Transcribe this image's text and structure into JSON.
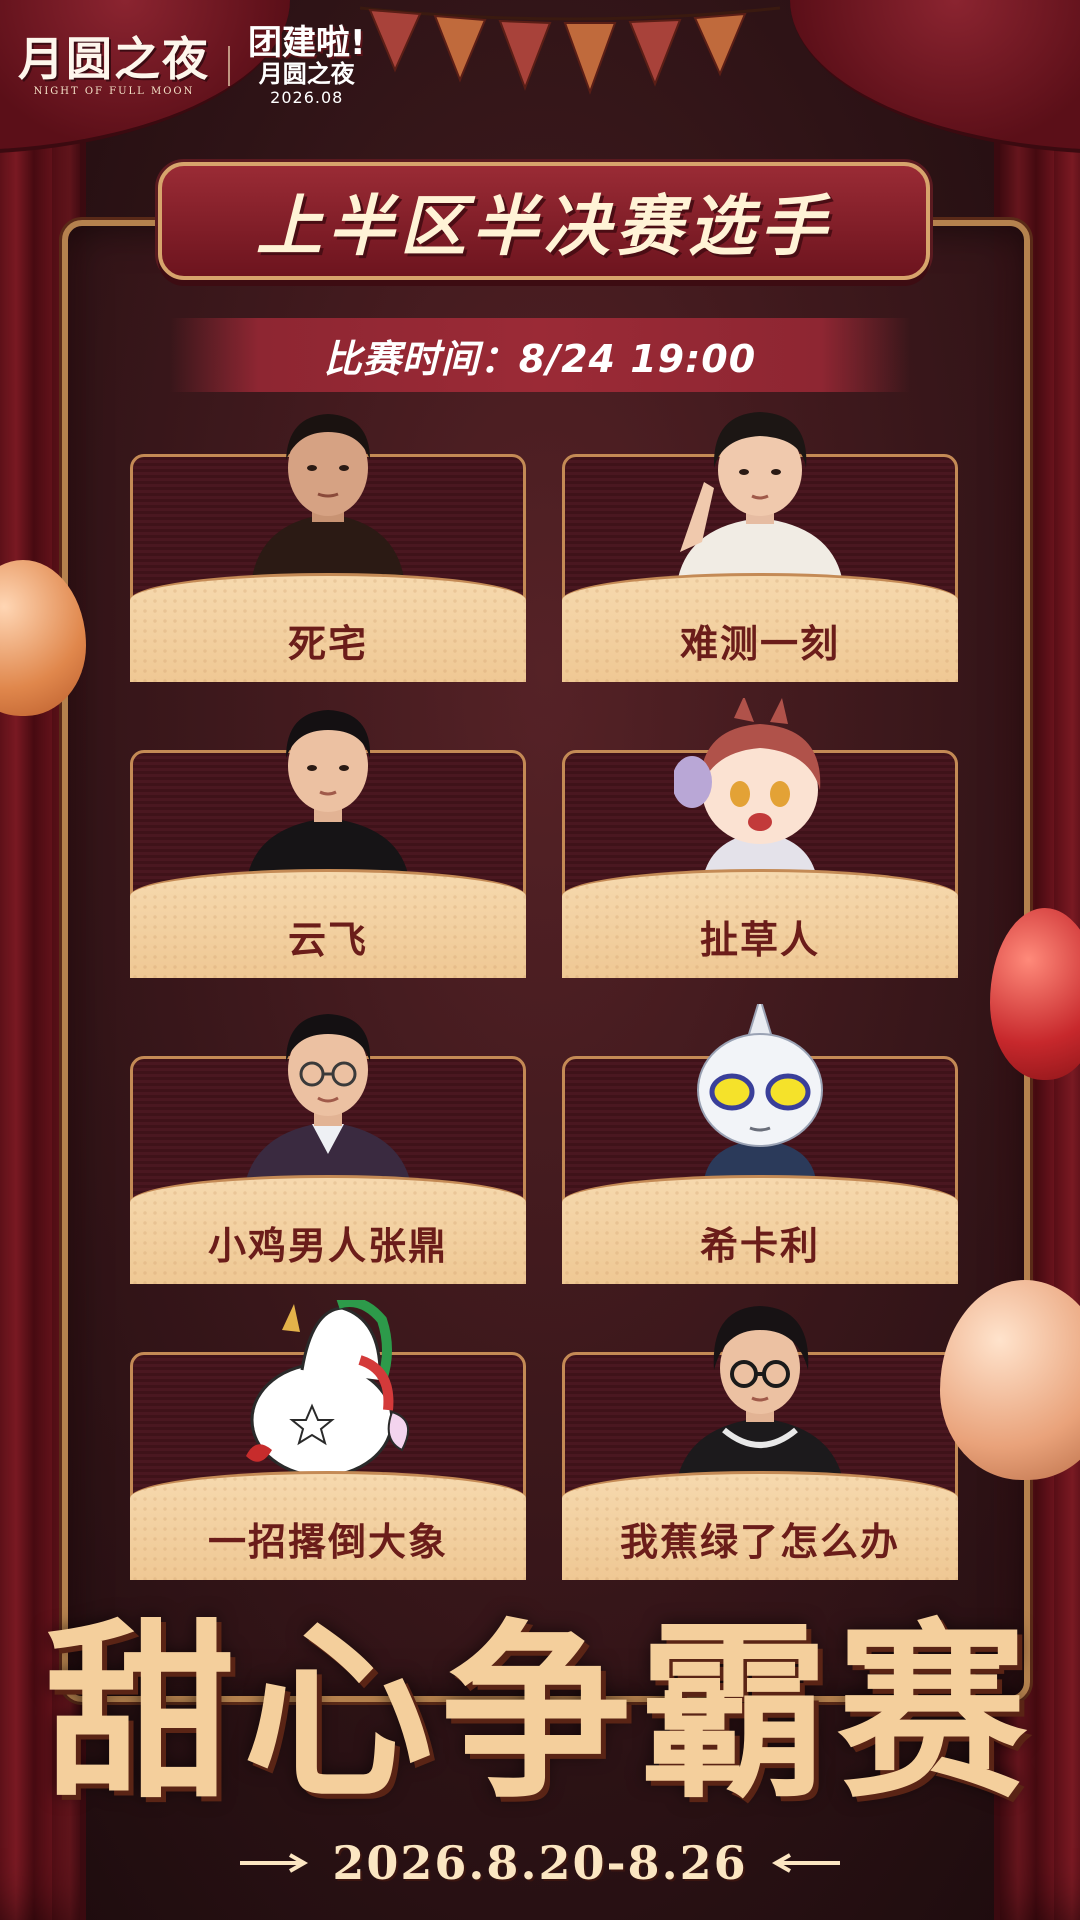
{
  "brand": {
    "logo_main": "月圆之夜",
    "logo_sub": "NIGHT OF FULL MOON",
    "event_title": "团建啦!",
    "event_sub": "月圆之夜",
    "event_date": "2026.08"
  },
  "header": {
    "title": "上半区半决赛选手",
    "match_time": "比赛时间：8/24 19:00"
  },
  "players": [
    {
      "name": "死宅",
      "avatar_icon": "player-photo-icon"
    },
    {
      "name": "难测一刻",
      "avatar_icon": "player-photo-icon"
    },
    {
      "name": "云飞",
      "avatar_icon": "player-photo-icon"
    },
    {
      "name": "扯草人",
      "avatar_icon": "anime-girl-avatar-icon"
    },
    {
      "name": "小鸡男人张鼎",
      "avatar_icon": "player-photo-icon"
    },
    {
      "name": "希卡利",
      "avatar_icon": "ultraman-avatar-icon"
    },
    {
      "name": "一招撂倒大象",
      "avatar_icon": "cartoon-unicorn-avatar-icon"
    },
    {
      "name": "我蕉绿了怎么办",
      "avatar_icon": "player-photo-icon"
    }
  ],
  "footer": {
    "title": "甜心争霸赛",
    "date_range": "2026.8.20-8.26"
  },
  "colors": {
    "background": "#2e1316",
    "frame_border": "#b5824e",
    "banner_red": "#8e2632",
    "card_cream": "#f6d9ae",
    "name_text": "#6b1d1a",
    "gold_text": "#f4cf9c"
  }
}
